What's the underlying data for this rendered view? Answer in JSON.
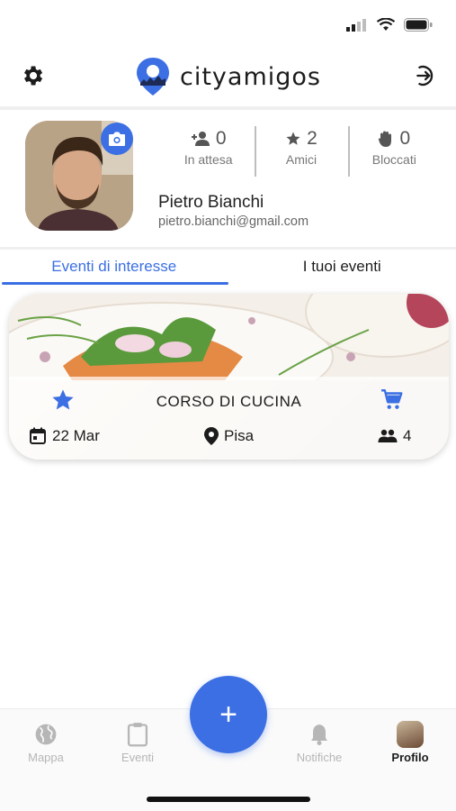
{
  "header": {
    "brand": "cityamigos"
  },
  "profile": {
    "name": "Pietro Bianchi",
    "email": "pietro.bianchi@gmail.com",
    "stats": [
      {
        "value": "0",
        "label": "In attesa",
        "icon": "person-add-icon"
      },
      {
        "value": "2",
        "label": "Amici",
        "icon": "star-icon"
      },
      {
        "value": "0",
        "label": "Bloccati",
        "icon": "hand-icon"
      }
    ]
  },
  "tabs": [
    {
      "label": "Eventi di interesse",
      "active": true
    },
    {
      "label": "I tuoi eventi",
      "active": false
    }
  ],
  "event": {
    "title": "CORSO DI CUCINA",
    "date": "22 Mar",
    "location": "Pisa",
    "participants": "4"
  },
  "nav": {
    "items": [
      {
        "label": "Mappa",
        "icon": "globe-icon"
      },
      {
        "label": "Eventi",
        "icon": "clipboard-icon"
      },
      {
        "label": "Notifiche",
        "icon": "bell-icon"
      },
      {
        "label": "Profilo",
        "icon": "avatar-icon"
      }
    ],
    "fab": "+"
  },
  "colors": {
    "accent": "#3b6fe3",
    "text": "#1c1c1c",
    "muted": "#777777"
  }
}
